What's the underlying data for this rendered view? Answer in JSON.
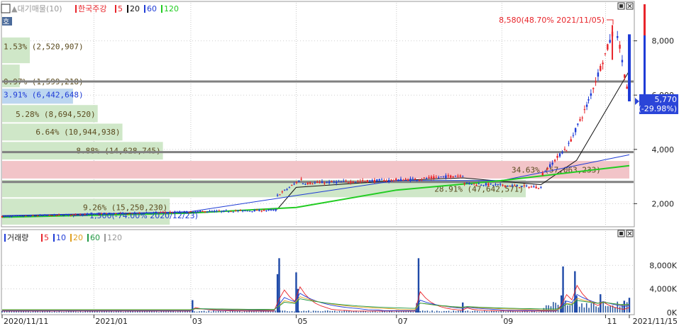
{
  "colors": {
    "up": "#e8242a",
    "down": "#1f3cd6",
    "ma5": "#e8242a",
    "ma20": "#111111",
    "ma60": "#1f3cd6",
    "ma120": "#22cc22",
    "profile": "#cfe7c8",
    "profile_active": "#f2c4c8",
    "profile_low_light": "#d6ebd0",
    "price_box": "#2b45d8",
    "hline": "#808080"
  },
  "window_controls": {
    "price_pane": [
      "▣",
      "✕"
    ],
    "volume_pane": [
      "▣",
      "✕"
    ]
  },
  "price_legend": {
    "prefix": "호",
    "item0": "▲대기매물(10)",
    "item1": "한국주강",
    "ma": [
      {
        "name": "5",
        "color": "#e8242a"
      },
      {
        "name": "20",
        "color": "#111111"
      },
      {
        "name": "60",
        "color": "#1f3cd6"
      },
      {
        "name": "120",
        "color": "#22cc22"
      }
    ]
  },
  "volume_legend": {
    "title": "거래량",
    "ma": [
      {
        "name": "5",
        "color": "#e8242a"
      },
      {
        "name": "10",
        "color": "#1f3cd6"
      },
      {
        "name": "20",
        "color": "#e0a020"
      },
      {
        "name": "60",
        "color": "#229944"
      },
      {
        "name": "120",
        "color": "#999999"
      }
    ]
  },
  "price_axis": {
    "ticks": [
      2000,
      4000,
      6000,
      8000
    ],
    "tick_labels": [
      "2,000",
      "4,000",
      "6,000",
      "8,000"
    ],
    "range": [
      1200,
      9400
    ]
  },
  "current_price": {
    "price": "5,770",
    "change": "(-29.98%)"
  },
  "annotations": {
    "high": "8,580(48.70% 2021/11/05)",
    "low": "1,500(-74.00% 2020/12/23)"
  },
  "volume_axis": {
    "ticks": [
      0,
      4000,
      8000
    ],
    "tick_labels": [
      "0K",
      "4,000K",
      "8,000K"
    ],
    "range": [
      0,
      12000
    ]
  },
  "x_axis": {
    "labels": [
      "2020/11/11",
      "2021/01",
      "03",
      "05",
      "07",
      "09",
      "11",
      "2021/11/15"
    ],
    "dates": [
      "2020-11-11",
      "2021-01-04",
      "2021-03-02",
      "2021-05-03",
      "2021-07-01",
      "2021-09-01",
      "2021-11-01",
      "2021-11-15"
    ]
  },
  "volume_profile": [
    {
      "price": 8500,
      "label": "",
      "value": 0
    },
    {
      "price": 7800,
      "label": "1.53% (2,520,907)",
      "value": 2520907
    },
    {
      "price": 6500,
      "label": "0.97% (1,599,218)",
      "value": 1599218
    },
    {
      "price": 6020,
      "label": "3.91% (6,442,648)",
      "value": 6442648,
      "highlight": true
    },
    {
      "price": 5300,
      "label": "5.28% (8,694,520)",
      "value": 8694520
    },
    {
      "price": 4650,
      "label": "6.64% (10,944,938)",
      "value": 10944938
    },
    {
      "price": 3950,
      "label": "8.88% (14,628,745)",
      "value": 14628745
    },
    {
      "price": 3250,
      "label": "34.63% (57,063,233)",
      "value": 57063233,
      "active": true
    },
    {
      "price": 2550,
      "label": "28.91% (47,642,571)",
      "value": 47642571
    },
    {
      "price": 1870,
      "label": "9.26% (15,250,230)",
      "value": 15250230
    }
  ],
  "horizontal_levels": [
    6500,
    3900,
    2800
  ],
  "chart_data": [
    {
      "type": "candlestick",
      "title": "한국주강",
      "x_start": "2020-11-11",
      "x_end": "2021-11-15",
      "high": {
        "date": "2021-11-05",
        "value": 8580,
        "pct": 48.7
      },
      "low": {
        "date": "2020-12-23",
        "value": 1500,
        "pct": -74.0
      },
      "last_close": 5770,
      "last_change_pct": -29.98,
      "segments": [
        {
          "from": "2020-11-11",
          "to": "2021-03-01",
          "start_price": 1520,
          "end_price": 1700
        },
        {
          "from": "2021-03-02",
          "to": "2021-04-21",
          "start_price": 1700,
          "end_price": 1760
        },
        {
          "from": "2021-04-22",
          "to": "2021-05-06",
          "start_price": 2300,
          "end_price": 2900
        },
        {
          "from": "2021-05-07",
          "to": "2021-07-12",
          "start_price": 2750,
          "end_price": 2900
        },
        {
          "from": "2021-07-13",
          "to": "2021-08-09",
          "start_price": 2900,
          "end_price": 3050
        },
        {
          "from": "2021-08-10",
          "to": "2021-09-24",
          "start_price": 2750,
          "end_price": 2600
        },
        {
          "from": "2021-09-25",
          "to": "2021-10-08",
          "start_price": 3100,
          "end_price": 4000
        },
        {
          "from": "2021-10-09",
          "to": "2021-10-21",
          "start_price": 4000,
          "end_price": 5600
        },
        {
          "from": "2021-10-22",
          "to": "2021-11-05",
          "start_price": 5800,
          "end_price": 8240
        },
        {
          "from": "2021-11-08",
          "to": "2021-11-15",
          "start_price": 8240,
          "end_price": 5770
        }
      ],
      "moving_averages": {
        "120": [
          {
            "date": "2020-11-11",
            "value": 1500
          },
          {
            "date": "2021-03-01",
            "value": 1650
          },
          {
            "date": "2021-05-03",
            "value": 1860
          },
          {
            "date": "2021-07-01",
            "value": 2500
          },
          {
            "date": "2021-09-01",
            "value": 2850
          },
          {
            "date": "2021-11-15",
            "value": 3400
          }
        ],
        "60": [
          {
            "date": "2020-11-11",
            "value": 1560
          },
          {
            "date": "2021-03-01",
            "value": 1700
          },
          {
            "date": "2021-05-03",
            "value": 2300
          },
          {
            "date": "2021-07-01",
            "value": 2850
          },
          {
            "date": "2021-09-01",
            "value": 2850
          },
          {
            "date": "2021-11-15",
            "value": 3800
          }
        ],
        "20": [
          {
            "date": "2020-11-11",
            "value": 1540
          },
          {
            "date": "2021-03-01",
            "value": 1680
          },
          {
            "date": "2021-04-22",
            "value": 1800
          },
          {
            "date": "2021-05-03",
            "value": 2600
          },
          {
            "date": "2021-07-01",
            "value": 2850
          },
          {
            "date": "2021-08-09",
            "value": 2950
          },
          {
            "date": "2021-09-24",
            "value": 2700
          },
          {
            "date": "2021-10-15",
            "value": 3600
          },
          {
            "date": "2021-11-15",
            "value": 6900
          }
        ]
      }
    },
    {
      "type": "bar",
      "title": "거래량",
      "unit": "K",
      "spikes": [
        {
          "date": "2021-03-03",
          "value": 2100
        },
        {
          "date": "2021-04-22",
          "value": 6500
        },
        {
          "date": "2021-04-23",
          "value": 9200
        },
        {
          "date": "2021-05-03",
          "value": 6800
        },
        {
          "date": "2021-05-04",
          "value": 4000
        },
        {
          "date": "2021-07-13",
          "value": 1600
        },
        {
          "date": "2021-07-14",
          "value": 9200
        },
        {
          "date": "2021-08-09",
          "value": 1700
        },
        {
          "date": "2021-10-06",
          "value": 2900
        },
        {
          "date": "2021-10-07",
          "value": 7800
        },
        {
          "date": "2021-10-14",
          "value": 7000
        },
        {
          "date": "2021-10-15",
          "value": 2800
        },
        {
          "date": "2021-10-29",
          "value": 3100
        },
        {
          "date": "2021-11-12",
          "value": 2000
        },
        {
          "date": "2021-11-15",
          "value": 2500
        }
      ],
      "baseline_level": 200
    }
  ]
}
